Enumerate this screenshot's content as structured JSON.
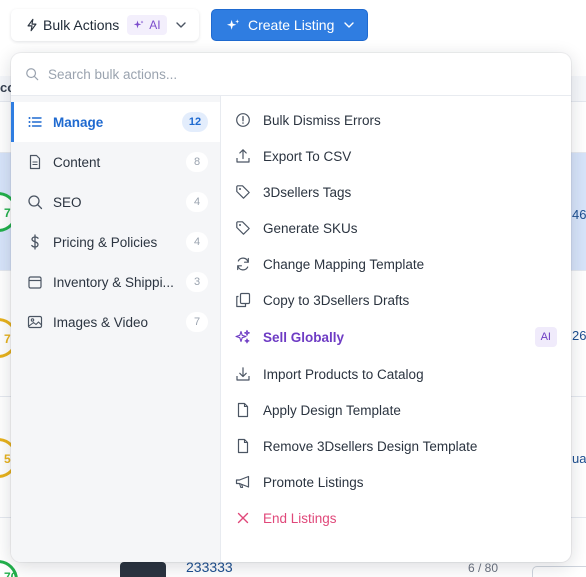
{
  "toolbar": {
    "bulk_actions_label": "Bulk Actions",
    "ai_badge": "AI",
    "create_listing_label": "Create Listing"
  },
  "background": {
    "column_header_fragment": "co",
    "row_values": [
      "46",
      "26",
      "ua"
    ],
    "score_fragments": [
      "7",
      "7",
      "5",
      "70"
    ],
    "bottom_row_title": "233333",
    "bottom_row_count": "6 / 80"
  },
  "search": {
    "placeholder": "Search bulk actions..."
  },
  "categories": [
    {
      "label": "Manage",
      "count": "12",
      "icon": "list-icon",
      "active": true
    },
    {
      "label": "Content",
      "count": "8",
      "icon": "document-icon",
      "active": false
    },
    {
      "label": "SEO",
      "count": "4",
      "icon": "search-icon",
      "active": false
    },
    {
      "label": "Pricing & Policies",
      "count": "4",
      "icon": "dollar-icon",
      "active": false
    },
    {
      "label": "Inventory & Shippi...",
      "count": "3",
      "icon": "box-icon",
      "active": false
    },
    {
      "label": "Images & Video",
      "count": "7",
      "icon": "image-icon",
      "active": false
    }
  ],
  "actions": [
    {
      "label": "Bulk Dismiss Errors",
      "icon": "alert-circle-icon"
    },
    {
      "label": "Export To CSV",
      "icon": "upload-icon"
    },
    {
      "label": "3Dsellers Tags",
      "icon": "tag-icon"
    },
    {
      "label": "Generate SKUs",
      "icon": "tag-icon"
    },
    {
      "label": "Change Mapping Template",
      "icon": "refresh-icon"
    },
    {
      "label": "Copy to 3Dsellers Drafts",
      "icon": "copy-icon"
    },
    {
      "label": "Sell Globally",
      "icon": "sparkle-icon",
      "badge": "AI"
    },
    {
      "label": "Import Products to Catalog",
      "icon": "download-icon"
    },
    {
      "label": "Apply Design Template",
      "icon": "file-icon"
    },
    {
      "label": "Remove 3Dsellers Design Template",
      "icon": "file-icon"
    },
    {
      "label": "Promote Listings",
      "icon": "megaphone-icon"
    },
    {
      "label": "End Listings",
      "icon": "close-icon"
    }
  ],
  "colors": {
    "primary": "#2f7de1",
    "ai_purple": "#6e3cc4",
    "danger": "#e0487a",
    "active_bg": "#e3edfc"
  }
}
